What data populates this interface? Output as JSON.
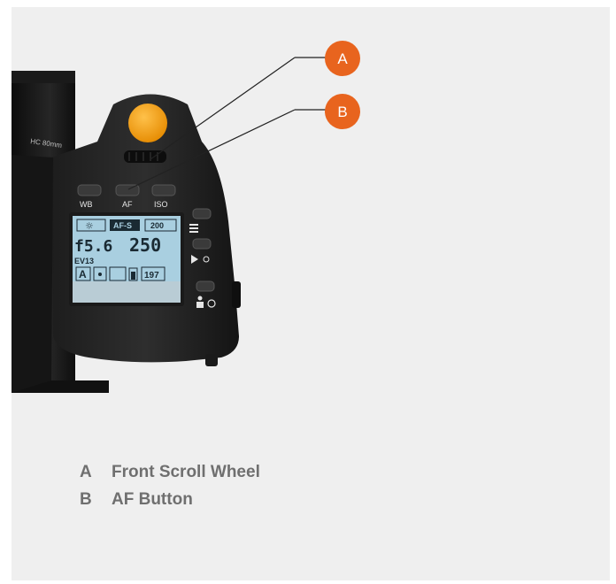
{
  "callouts": [
    {
      "letter": "A",
      "label": "Front Scroll Wheel"
    },
    {
      "letter": "B",
      "label": "AF Button"
    }
  ],
  "camera": {
    "lens_text": "HC 80mm",
    "buttons": {
      "wb": "WB",
      "af": "AF",
      "iso": "ISO"
    },
    "lcd": {
      "row1": {
        "sun": "☼",
        "mode": "AF-S",
        "iso": "200"
      },
      "aperture": "f5.6",
      "shutter": "250",
      "ev": "EV13",
      "row3": {
        "mode": "A",
        "shots": "197"
      }
    }
  },
  "colors": {
    "callout": "#e8641e",
    "shutter_button": "#f29a12",
    "background": "#efefef",
    "legend_text": "#6f6f6f",
    "lcd": "#a9cfe0"
  }
}
